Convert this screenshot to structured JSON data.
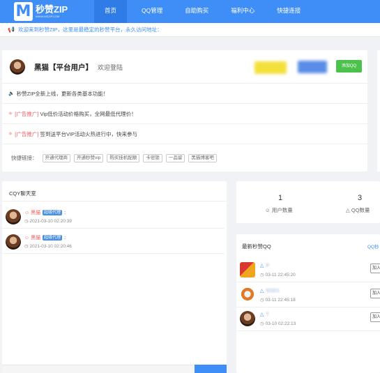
{
  "brand": {
    "logo_letter": "M",
    "name": "秒赞ZIP",
    "url_text": "WWW.MSZIP.COM"
  },
  "nav": {
    "items": [
      "首页",
      "QQ管理",
      "自助购买",
      "福利中心",
      "快捷连接"
    ]
  },
  "notice": {
    "icon": "megaphone-icon",
    "text": "欢迎来到秒赞ZIP，这里是最稳定的秒赞平台，永久访问地址："
  },
  "user": {
    "name": "黑猫【平台用户】",
    "welcome": "欢迎登陆",
    "add_qq_label": "添加QQ"
  },
  "messages": [
    {
      "icon": "speaker-icon",
      "tag": "",
      "text": "秒赞ZIP全新上线，更新各类基本功能！"
    },
    {
      "icon": "ad-icon",
      "tag": "[广告推广]",
      "text": "Vip低价活动价格购买，全网最低代理价！"
    },
    {
      "icon": "ad-icon",
      "tag": "[广告推广]",
      "text": "签到送平台VIP活动火热进行中，快来参与"
    }
  ],
  "quick_links": {
    "label": "快捷链接：",
    "items": [
      "开通代理商",
      "开通秒赞vip",
      "购买挂机配额",
      "卡密锁",
      "一品留",
      "黑猫博客吧"
    ]
  },
  "chat": {
    "title": "CQY聊天室",
    "items": [
      {
        "user": "黑猫",
        "badge": "超级代理",
        "time": "2021-03-10 02:20:39"
      },
      {
        "user": "黑猫",
        "badge": "超级代理",
        "time": "2021-03-10 02:20:46"
      }
    ]
  },
  "stats": [
    {
      "value": "1",
      "label": "用户数量",
      "icon": "user-icon"
    },
    {
      "value": "3",
      "label": "QQ数量",
      "icon": "qq-icon"
    }
  ],
  "latest": {
    "title": "最新秒赞QQ",
    "more": "QQ秒",
    "items": [
      {
        "qq": "P",
        "time": "03-11 22:45:20",
        "join": "加入"
      },
      {
        "qq": "52321",
        "time": "03-11 22:45:18",
        "join": "加入"
      },
      {
        "qq": "T",
        "time": "03-10 02:22:13",
        "join": "加入"
      }
    ]
  },
  "colors": {
    "primary": "#3f8ef7",
    "green": "#4cc14c",
    "red": "#f25c5c"
  }
}
